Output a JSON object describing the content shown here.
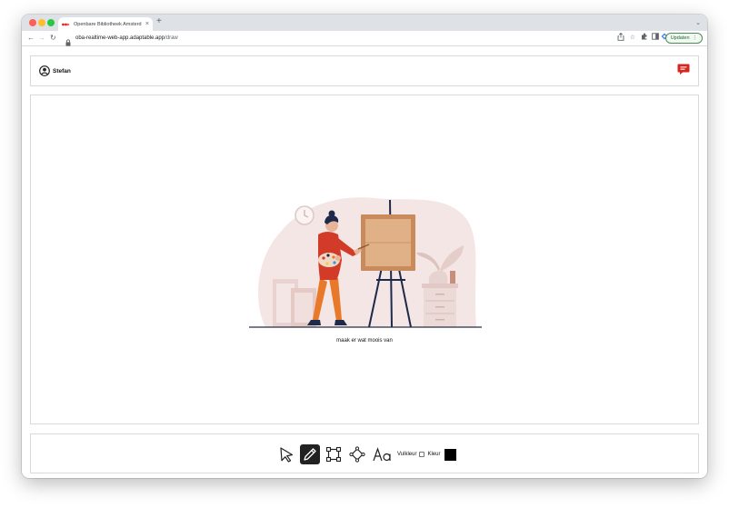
{
  "browser": {
    "tab_title": "Openbare Bibliotheek Amsterd",
    "tab_close": "×",
    "new_tab": "+",
    "url_host": "oba-realtime-web-app.adaptable.app",
    "url_path": "/draw",
    "update_label": "Updaten",
    "update_more": "⋮",
    "icons": [
      "back-arrow-icon",
      "forward-arrow-icon",
      "reload-icon",
      "lock-icon",
      "share-icon",
      "star-icon",
      "extensions-icon",
      "sidepanel-icon",
      "profile-icon"
    ]
  },
  "header": {
    "user_name": "Stefan",
    "chat_color": "#d7261e"
  },
  "canvas": {
    "caption": "maak er wat moois van"
  },
  "toolbar": {
    "tools": [
      "select-icon",
      "pencil-icon",
      "rectangle-icon",
      "shape-icon",
      "text-icon"
    ],
    "active_tool": "pencil",
    "fill_label": "Vulkleur",
    "fill_checked": false,
    "color_label": "Kleur",
    "color_value": "#000000"
  }
}
